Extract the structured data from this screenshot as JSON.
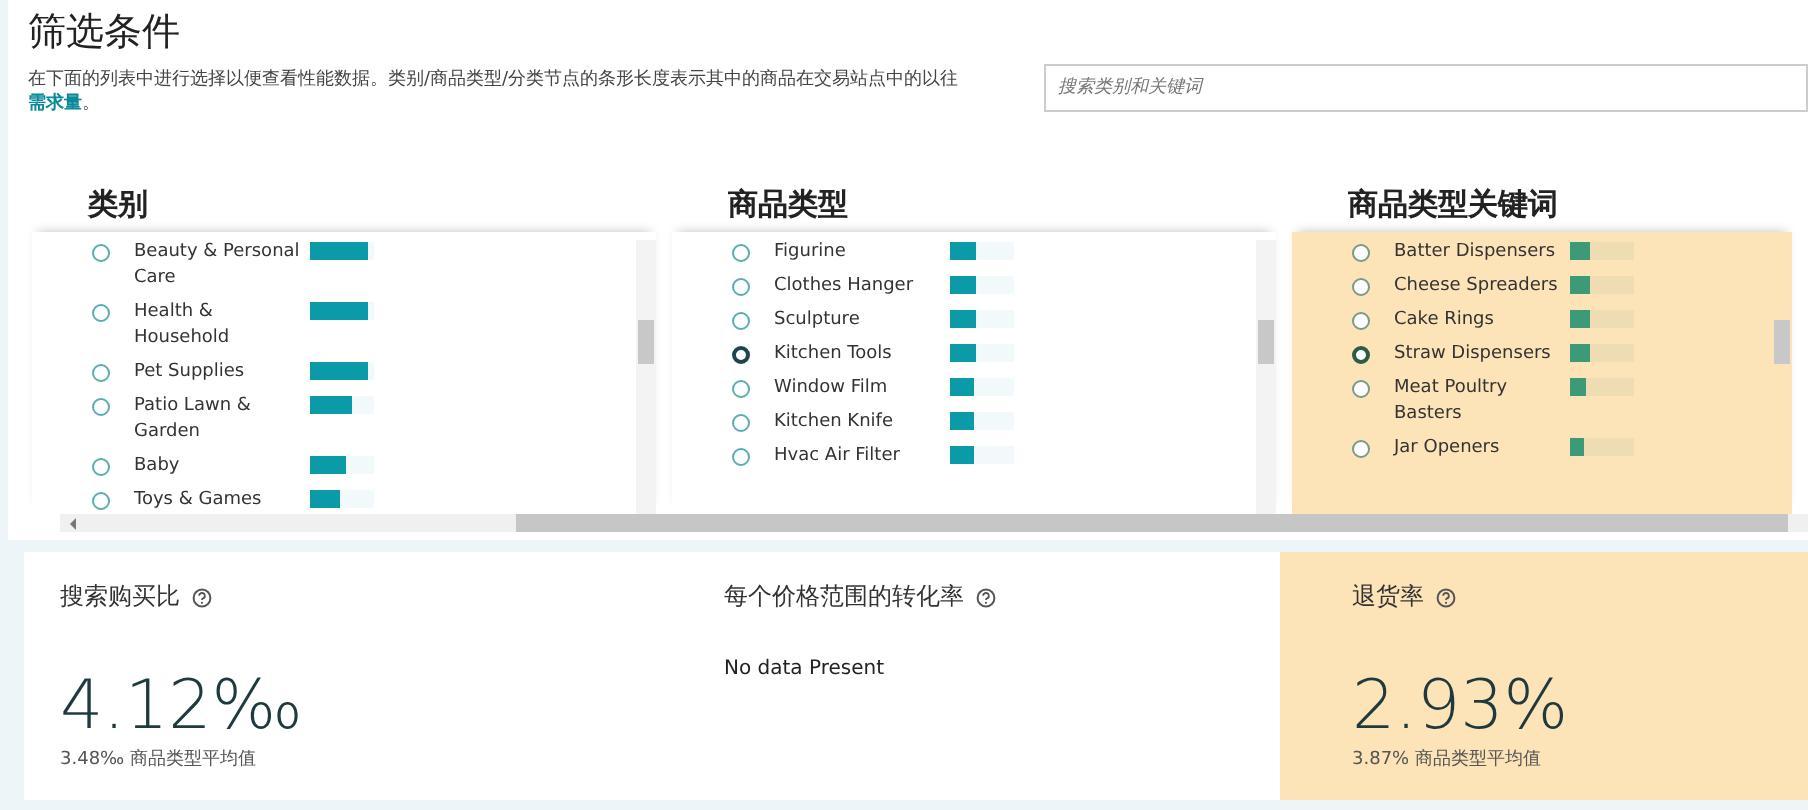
{
  "title": "筛选条件",
  "description": {
    "text": "在下面的列表中进行选择以便查看性能数据。类别/商品类型/分类节点的条形长度表示其中的商品在交易站点中的以往",
    "link": "需求量",
    "end": "。"
  },
  "search": {
    "placeholder": "搜索类别和关键词"
  },
  "columns": [
    {
      "title": "类别",
      "highlighted": false,
      "items": [
        {
          "label": "Beauty & Personal Care",
          "selected": false,
          "level": 0.9
        },
        {
          "label": "Health & Household",
          "selected": false,
          "level": 0.9
        },
        {
          "label": "Pet Supplies",
          "selected": false,
          "level": 0.9
        },
        {
          "label": "Patio Lawn & Garden",
          "selected": false,
          "level": 0.65
        },
        {
          "label": "Baby",
          "selected": false,
          "level": 0.57
        },
        {
          "label": "Toys & Games",
          "selected": false,
          "level": 0.47
        }
      ]
    },
    {
      "title": "商品类型",
      "highlighted": false,
      "items": [
        {
          "label": "Figurine",
          "selected": false,
          "level": 0.4
        },
        {
          "label": "Clothes Hanger",
          "selected": false,
          "level": 0.4
        },
        {
          "label": "Sculpture",
          "selected": false,
          "level": 0.4
        },
        {
          "label": "Kitchen Tools",
          "selected": true,
          "level": 0.4
        },
        {
          "label": "Window Film",
          "selected": false,
          "level": 0.37
        },
        {
          "label": "Kitchen Knife",
          "selected": false,
          "level": 0.37
        },
        {
          "label": "Hvac Air Filter",
          "selected": false,
          "level": 0.37
        }
      ]
    },
    {
      "title": "商品类型关键词",
      "highlighted": true,
      "items": [
        {
          "label": "Batter Dispensers",
          "selected": false,
          "level": 0.3
        },
        {
          "label": "Cheese Spreaders",
          "selected": false,
          "level": 0.3
        },
        {
          "label": "Cake Rings",
          "selected": false,
          "level": 0.3
        },
        {
          "label": "Straw Dispensers",
          "selected": true,
          "level": 0.3
        },
        {
          "label": "Meat Poultry Basters",
          "selected": false,
          "level": 0.25
        },
        {
          "label": "Jar Openers",
          "selected": false,
          "level": 0.23
        }
      ]
    }
  ],
  "metrics": [
    {
      "title": "搜索购买比",
      "highlighted": false,
      "value": "4.12‰",
      "average": "3.48‰ 商品类型平均值"
    },
    {
      "title": "每个价格范围的转化率",
      "highlighted": false,
      "message": "No data Present"
    },
    {
      "title": "退货率",
      "highlighted": true,
      "value": "2.93%",
      "average": "3.87% 商品类型平均值"
    }
  ]
}
